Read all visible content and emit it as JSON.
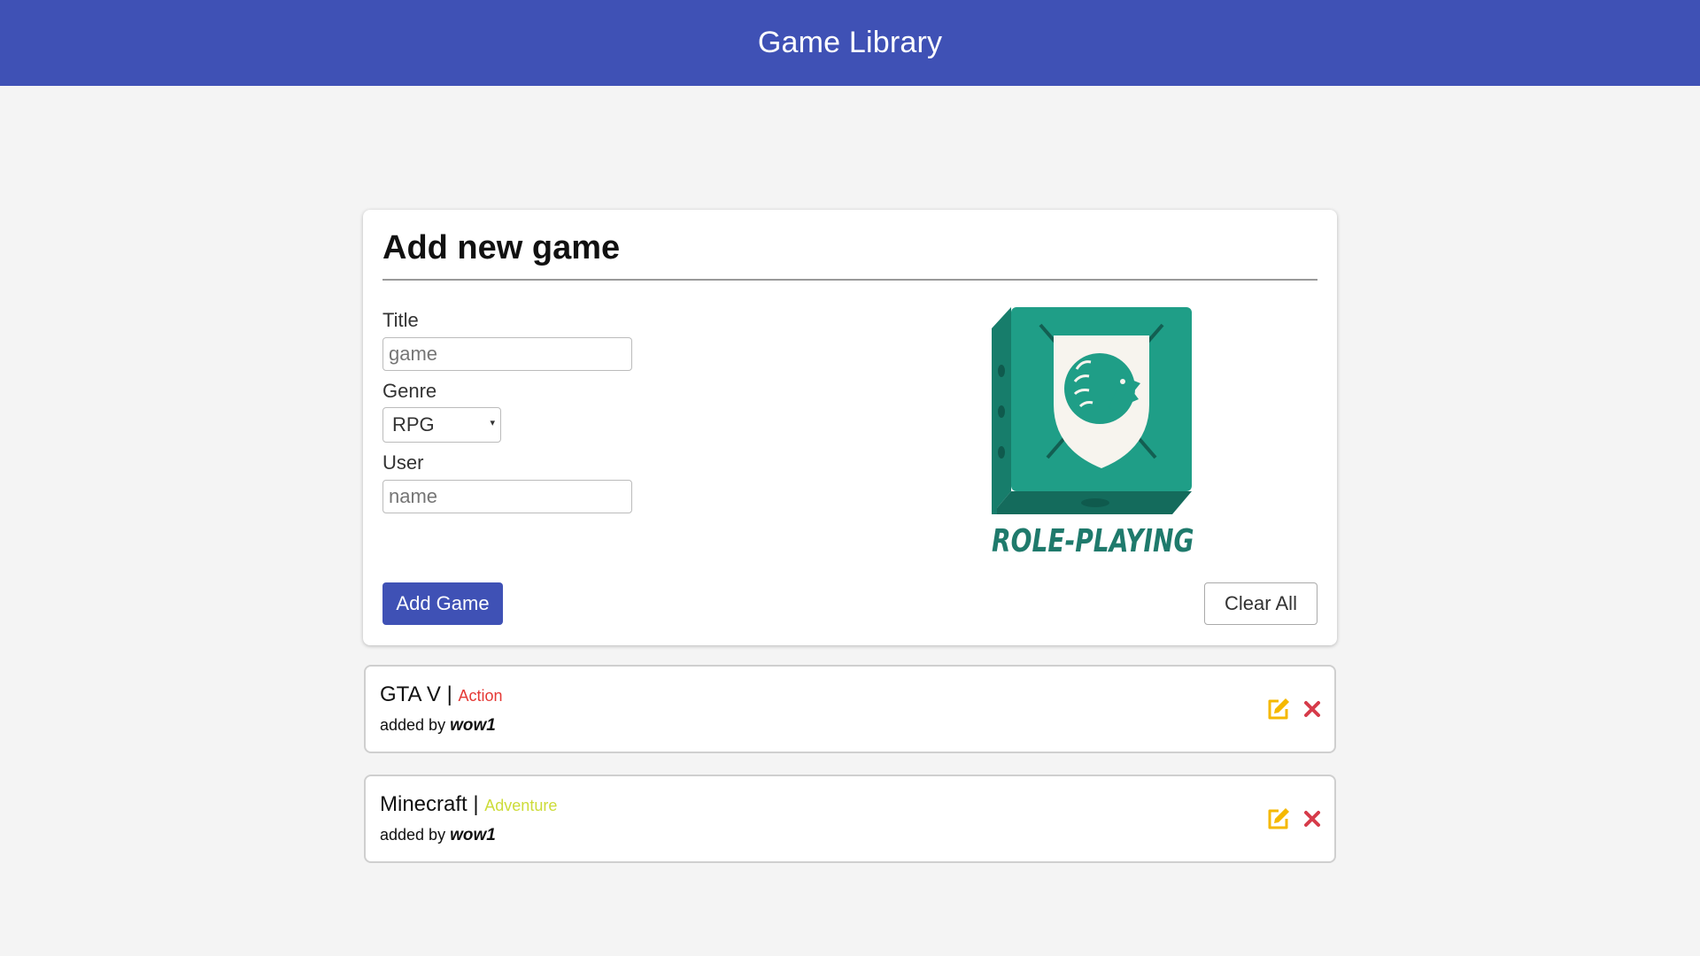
{
  "header": {
    "title": "Game Library"
  },
  "form": {
    "heading": "Add new game",
    "title_label": "Title",
    "title_placeholder": "game",
    "genre_label": "Genre",
    "genre_selected": "RPG",
    "user_label": "User",
    "user_placeholder": "name",
    "add_button": "Add Game",
    "clear_button": "Clear All",
    "genre_art_caption": "ROLE-PLAYING"
  },
  "games": [
    {
      "title": "GTA V",
      "separator": "|",
      "genre": "Action",
      "genre_color": "#e53935",
      "added_by_label": "added by",
      "user": "wow1"
    },
    {
      "title": "Minecraft",
      "separator": "|",
      "genre": "Adventure",
      "genre_color": "#cddc39",
      "added_by_label": "added by",
      "user": "wow1"
    }
  ],
  "icons": {
    "edit": "edit-icon",
    "delete": "close-icon"
  },
  "colors": {
    "primary": "#3f51b5",
    "edit_icon": "#f5b800",
    "delete_icon": "#d63b4a",
    "art_teal": "#1f9e87"
  }
}
